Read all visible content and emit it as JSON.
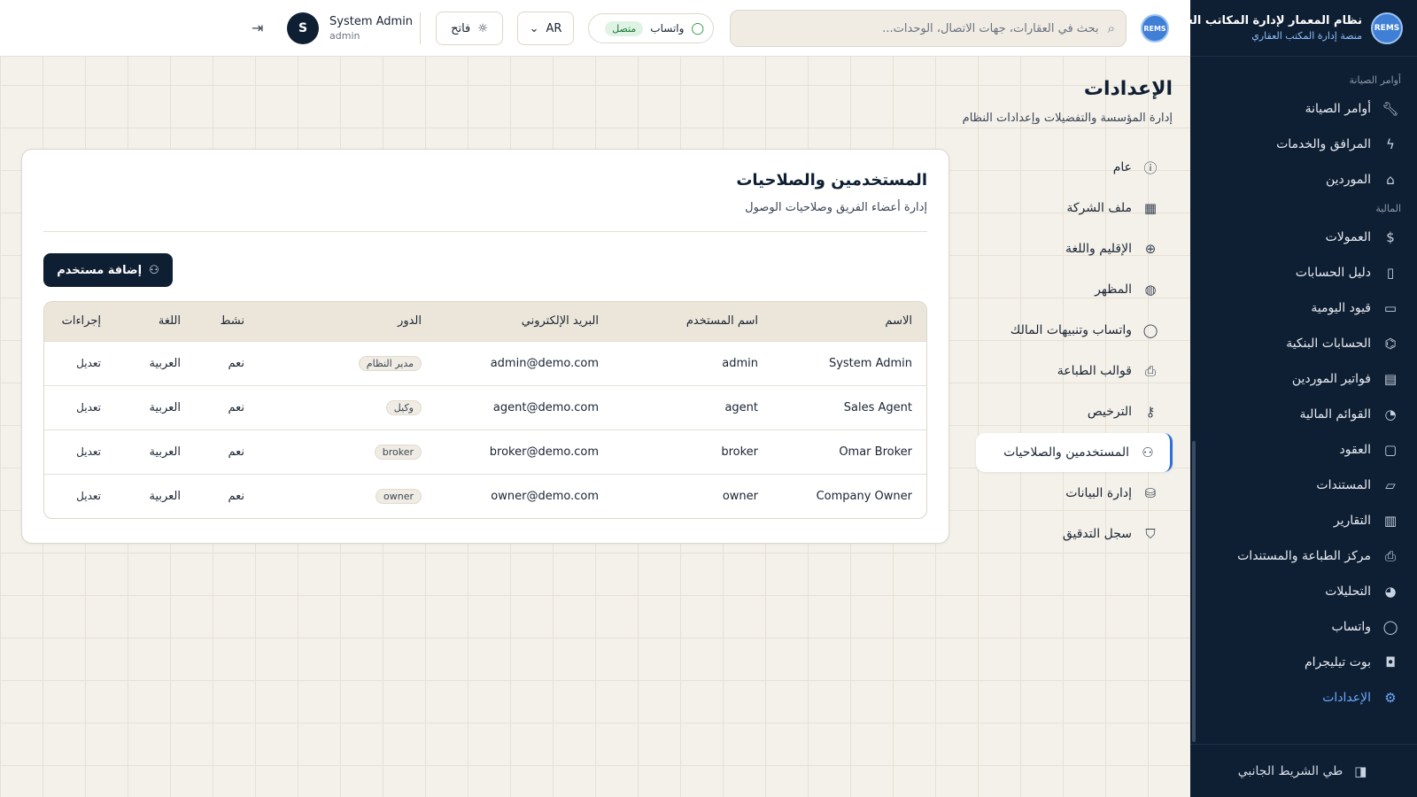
{
  "brand": {
    "logo_text": "REMS",
    "title": "نظام المعمار لإدارة المكاتب العقارية",
    "subtitle": "منصة إدارة المكتب العقاري"
  },
  "topbar": {
    "search_placeholder": "بحث في العقارات، جهات الاتصال، الوحدات...",
    "whatsapp_label": "واتساب",
    "whatsapp_status": "متصل",
    "language": "AR",
    "theme_label": "فاتح",
    "user_initial": "S",
    "user_name": "System Admin",
    "user_role": "admin"
  },
  "sidebar": {
    "section_maintenance": "أوامر الصيانة",
    "section_finance": "المالية",
    "items": [
      {
        "label": "أوامر الصيانة",
        "icon": "wrench-icon"
      },
      {
        "label": "المرافق والخدمات",
        "icon": "bolt-icon"
      },
      {
        "label": "الموردين",
        "icon": "vendor-icon"
      },
      {
        "label": "العمولات",
        "icon": "dollar-icon"
      },
      {
        "label": "دليل الحسابات",
        "icon": "book-icon"
      },
      {
        "label": "قيود اليومية",
        "icon": "book-open-icon"
      },
      {
        "label": "الحسابات البنكية",
        "icon": "bank-icon"
      },
      {
        "label": "فواتير الموردين",
        "icon": "invoice-icon"
      },
      {
        "label": "القوائم المالية",
        "icon": "pie-chart-icon"
      },
      {
        "label": "العقود",
        "icon": "document-icon"
      },
      {
        "label": "المستندات",
        "icon": "folder-icon"
      },
      {
        "label": "التقارير",
        "icon": "bar-chart-icon"
      },
      {
        "label": "مركز الطباعة والمستندات",
        "icon": "printer-icon"
      },
      {
        "label": "التحليلات",
        "icon": "analytics-icon"
      },
      {
        "label": "واتساب",
        "icon": "chat-icon"
      },
      {
        "label": "بوت تيليجرام",
        "icon": "bot-icon"
      },
      {
        "label": "الإعدادات",
        "icon": "gear-icon"
      }
    ],
    "collapse_label": "طي الشريط الجانبي"
  },
  "page": {
    "title": "الإعدادات",
    "subtitle": "إدارة المؤسسة والتفضيلات وإعدادات النظام"
  },
  "settings_nav": [
    {
      "label": "عام",
      "icon": "info-icon"
    },
    {
      "label": "ملف الشركة",
      "icon": "building-icon"
    },
    {
      "label": "الإقليم واللغة",
      "icon": "globe-icon"
    },
    {
      "label": "المظهر",
      "icon": "palette-icon"
    },
    {
      "label": "واتساب وتنبيهات المالك",
      "icon": "chat-icon"
    },
    {
      "label": "قوالب الطباعة",
      "icon": "printer-icon"
    },
    {
      "label": "الترخيص",
      "icon": "key-icon"
    },
    {
      "label": "المستخدمين والصلاحيات",
      "icon": "users-icon"
    },
    {
      "label": "إدارة البيانات",
      "icon": "database-icon"
    },
    {
      "label": "سجل التدقيق",
      "icon": "shield-icon"
    }
  ],
  "card": {
    "title": "المستخدمين والصلاحيات",
    "subtitle": "إدارة أعضاء الفريق وصلاحيات الوصول",
    "add_button": "إضافة مستخدم"
  },
  "table": {
    "headers": {
      "name": "الاسم",
      "username": "اسم المستخدم",
      "email": "البريد الإلكتروني",
      "role": "الدور",
      "active": "نشط",
      "language": "اللغة",
      "actions": "إجراءات"
    },
    "rows": [
      {
        "name": "System Admin",
        "username": "admin",
        "email": "admin@demo.com",
        "role": "مدير النظام",
        "active": "نعم",
        "language": "العربية",
        "action": "تعديل"
      },
      {
        "name": "Sales Agent",
        "username": "agent",
        "email": "agent@demo.com",
        "role": "وكيل",
        "active": "نعم",
        "language": "العربية",
        "action": "تعديل"
      },
      {
        "name": "Omar Broker",
        "username": "broker",
        "email": "broker@demo.com",
        "role": "broker",
        "active": "نعم",
        "language": "العربية",
        "action": "تعديل"
      },
      {
        "name": "Company Owner",
        "username": "owner",
        "email": "owner@demo.com",
        "role": "owner",
        "active": "نعم",
        "language": "العربية",
        "action": "تعديل"
      }
    ]
  }
}
